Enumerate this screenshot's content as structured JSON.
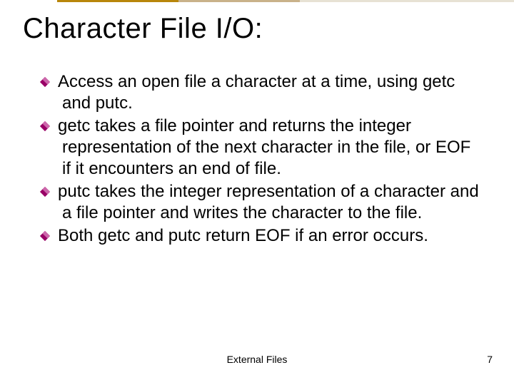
{
  "title": "Character File I/O:",
  "bullets": [
    " Access an open file a character at a time, using getc and putc.",
    " getc takes a file pointer and returns the integer representation of the next character in the file, or EOF if it encounters an end of file.",
    " putc takes the integer representation of a character and a file pointer and writes the character to the file.",
    " Both getc and putc return EOF if an error occurs."
  ],
  "footer": "External Files",
  "page": "7",
  "colors": {
    "bullet_main": "#990066",
    "bullet_highlight": "#cc66aa",
    "accent1": "#b8860b",
    "accent2": "#c9b28a",
    "accent3": "#e7e2d4"
  }
}
